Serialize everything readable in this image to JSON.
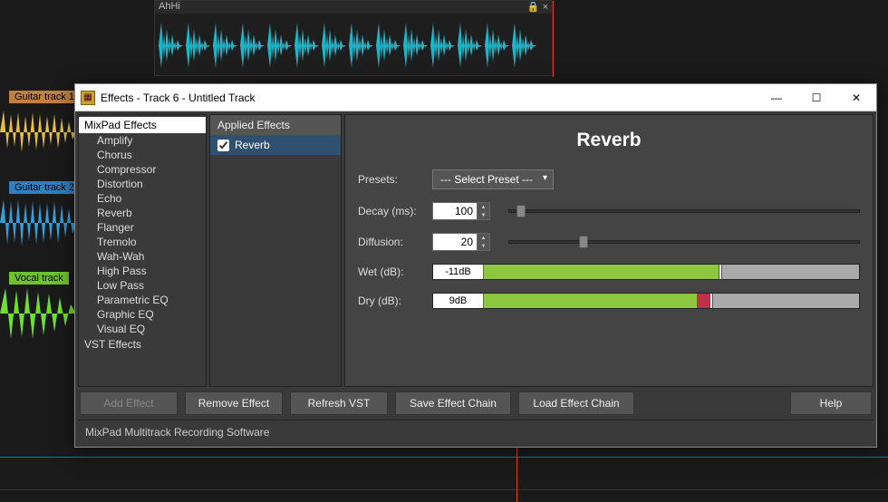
{
  "bg": {
    "clip_label": "AhHi",
    "tracks": [
      {
        "name": "Guitar track 1",
        "color": "orange"
      },
      {
        "name": "Guitar track 2",
        "color": "blue"
      },
      {
        "name": "Vocal track",
        "color": "green"
      }
    ]
  },
  "dialog": {
    "title": "Effects - Track 6 - Untitled Track",
    "tree": {
      "cat1": "MixPad Effects",
      "items": [
        "Amplify",
        "Chorus",
        "Compressor",
        "Distortion",
        "Echo",
        "Reverb",
        "Flanger",
        "Tremolo",
        "Wah-Wah",
        "High Pass",
        "Low Pass",
        "Parametric EQ",
        "Graphic EQ",
        "Visual EQ"
      ],
      "cat2": "VST Effects"
    },
    "applied": {
      "header": "Applied Effects",
      "items": [
        {
          "label": "Reverb",
          "checked": true
        }
      ]
    },
    "effect": {
      "title": "Reverb",
      "presets_label": "Presets:",
      "presets_value": "--- Select Preset ---",
      "params": {
        "decay_label": "Decay (ms):",
        "decay_value": "100",
        "decay_slider_pct": 2,
        "diffusion_label": "Diffusion:",
        "diffusion_value": "20",
        "diffusion_slider_pct": 20,
        "wet_label": "Wet (dB):",
        "wet_value": "-11dB",
        "wet_fill_pct": 55,
        "dry_label": "Dry (dB):",
        "dry_value": "9dB",
        "dry_fill_pct": 50,
        "dry_red_pct": 3
      }
    },
    "buttons": {
      "add": "Add Effect",
      "remove": "Remove Effect",
      "refresh": "Refresh VST",
      "save": "Save Effect Chain",
      "load": "Load Effect Chain",
      "help": "Help"
    },
    "footer": "MixPad Multitrack Recording Software"
  }
}
